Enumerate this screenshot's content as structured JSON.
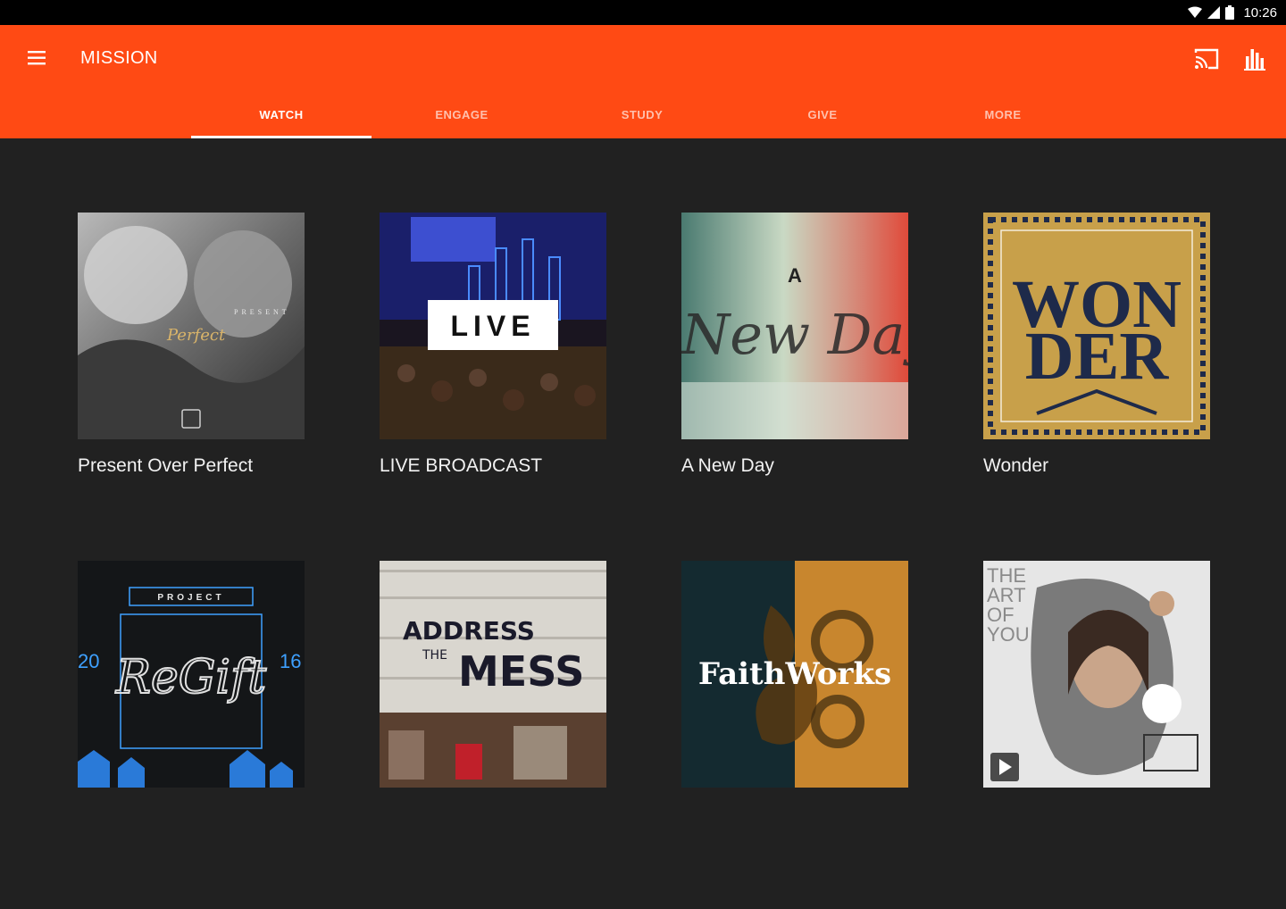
{
  "status_bar": {
    "time": "10:26",
    "icons": [
      "wifi-icon",
      "signal-icon",
      "battery-icon"
    ]
  },
  "app_bar": {
    "title": "MISSION",
    "brand_color": "#ff4a14",
    "icons": [
      "menu-icon",
      "cast-icon",
      "stats-icon"
    ]
  },
  "tabs": [
    {
      "label": "WATCH",
      "active": true
    },
    {
      "label": "ENGAGE",
      "active": false
    },
    {
      "label": "STUDY",
      "active": false
    },
    {
      "label": "GIVE",
      "active": false
    },
    {
      "label": "MORE",
      "active": false
    }
  ],
  "cards": [
    {
      "title": "Present Over Perfect",
      "art_text": [
        "PRESENT",
        "Perfect"
      ]
    },
    {
      "title": "LIVE BROADCAST",
      "art_text": [
        "LIVE"
      ]
    },
    {
      "title": "A New Day",
      "art_text": [
        "A",
        "New Day"
      ]
    },
    {
      "title": "Wonder",
      "art_text": [
        "WON",
        "DER"
      ]
    },
    {
      "title": "",
      "art_text": [
        "PROJECT",
        "20",
        "ReGift",
        "16"
      ]
    },
    {
      "title": "",
      "art_text": [
        "ADDRESS",
        "THE",
        "MESS"
      ]
    },
    {
      "title": "",
      "art_text": [
        "FaithWorks"
      ]
    },
    {
      "title": "",
      "art_text": [
        "THE",
        "ART",
        "OF",
        "YOU"
      ]
    }
  ]
}
